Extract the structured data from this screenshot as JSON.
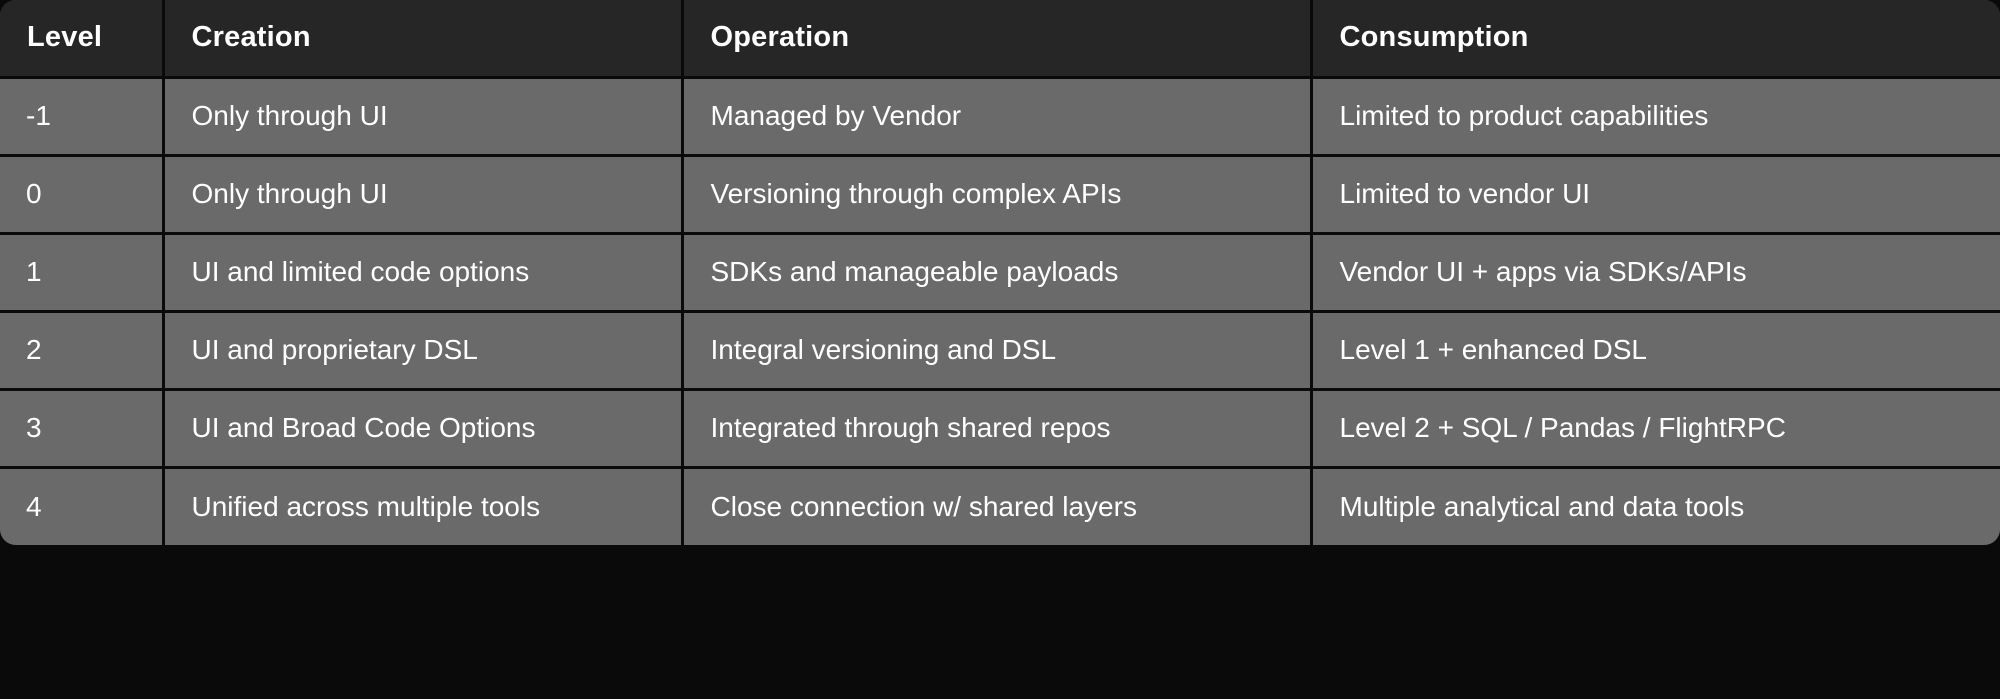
{
  "table": {
    "name": "data-product-maturity-matrix",
    "columns": [
      {
        "key": "level",
        "label": "Level"
      },
      {
        "key": "creation",
        "label": "Creation"
      },
      {
        "key": "operation",
        "label": "Operation"
      },
      {
        "key": "consumption",
        "label": "Consumption"
      }
    ],
    "rows": [
      {
        "level": "-1",
        "creation": "Only through UI",
        "operation": "Managed by Vendor",
        "consumption": "Limited to product capabilities"
      },
      {
        "level": "0",
        "creation": "Only through UI",
        "operation": "Versioning through complex APIs",
        "consumption": "Limited to vendor UI"
      },
      {
        "level": "1",
        "creation": "UI and limited code options",
        "operation": "SDKs and manageable payloads",
        "consumption": "Vendor UI + apps via SDKs/APIs"
      },
      {
        "level": "2",
        "creation": "UI and proprietary DSL",
        "operation": "Integral versioning and DSL",
        "consumption": "Level 1 + enhanced DSL"
      },
      {
        "level": "3",
        "creation": "UI and Broad Code Options",
        "operation": "Integrated through shared repos",
        "consumption": "Level 2 + SQL / Pandas / FlightRPC"
      },
      {
        "level": "4",
        "creation": "Unified across multiple tools",
        "operation": "Close connection w/ shared layers",
        "consumption": "Multiple analytical and data tools"
      }
    ]
  },
  "colors": {
    "page_background": "#0a0a0a",
    "header_background": "#262626",
    "cell_background": "#6a6a6a",
    "grid_line": "#0a0a0a",
    "text": "#ffffff"
  }
}
